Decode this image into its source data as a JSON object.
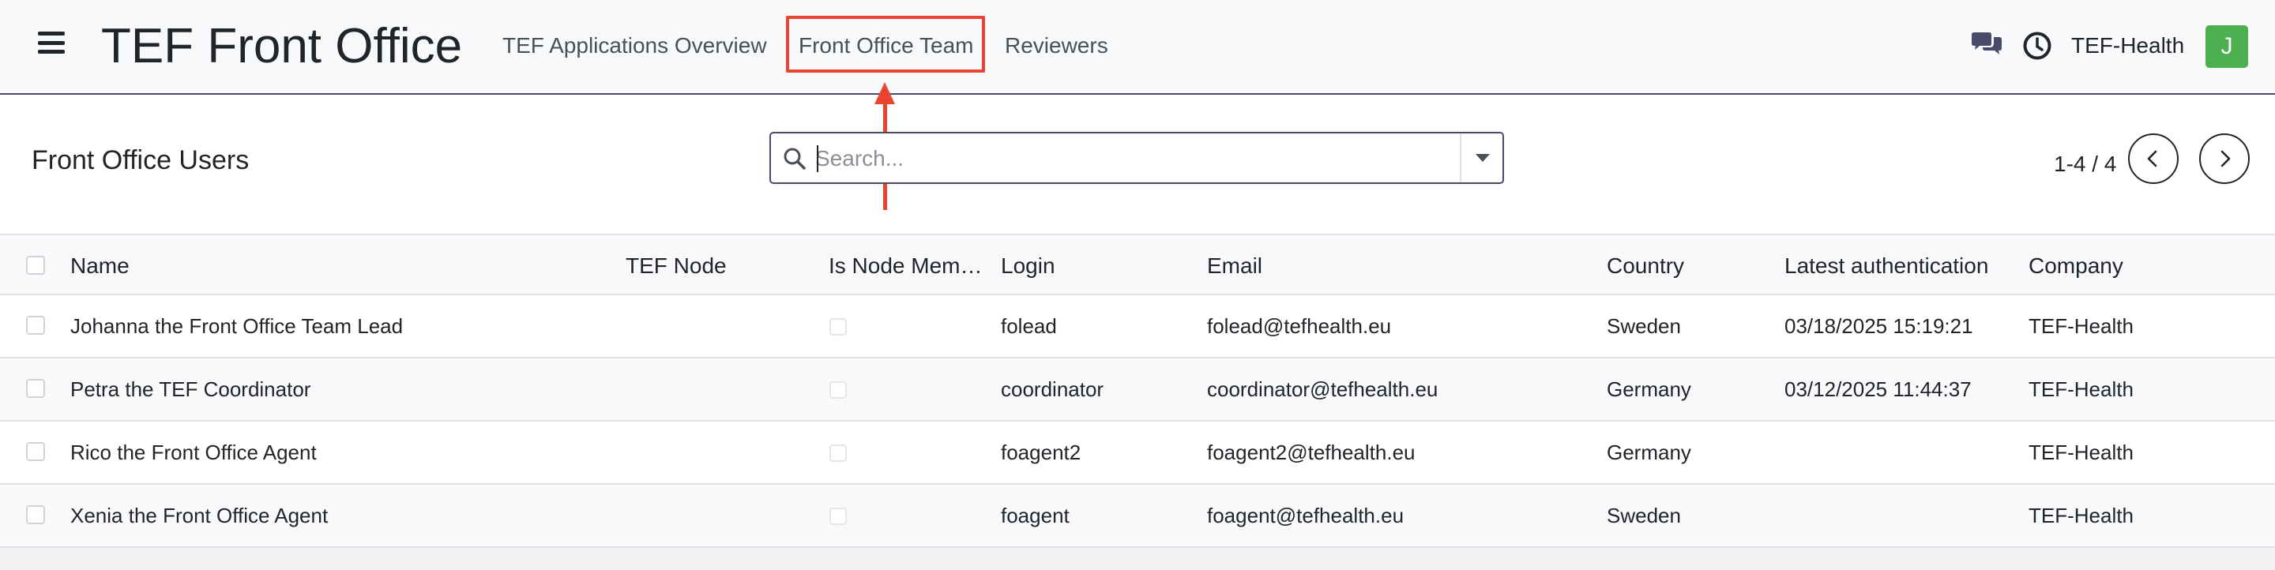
{
  "navbar": {
    "brand": "TEF Front Office",
    "menu": [
      {
        "label": "TEF Applications Overview"
      },
      {
        "label": "Front Office Team"
      },
      {
        "label": "Reviewers"
      }
    ],
    "company": "TEF-Health",
    "avatar_initial": "J",
    "icons": [
      "hamburger-icon",
      "chat-icon",
      "clock-icon"
    ]
  },
  "control_panel": {
    "title": "Front Office Users",
    "search": {
      "placeholder": "Search...",
      "value": ""
    },
    "pager": {
      "value": "1-4 / 4"
    }
  },
  "list": {
    "columns": [
      "Name",
      "TEF Node",
      "Is Node Mem…",
      "Login",
      "Email",
      "Country",
      "Latest authentication",
      "Company"
    ],
    "rows": [
      {
        "name": "Johanna the Front Office Team Lead",
        "tef_node": "",
        "login": "folead",
        "email": "folead@tefhealth.eu",
        "country": "Sweden",
        "latest_auth": "03/18/2025 15:19:21",
        "company": "TEF-Health"
      },
      {
        "name": "Petra the TEF Coordinator",
        "tef_node": "",
        "login": "coordinator",
        "email": "coordinator@tefhealth.eu",
        "country": "Germany",
        "latest_auth": "03/12/2025 11:44:37",
        "company": "TEF-Health"
      },
      {
        "name": "Rico the Front Office Agent",
        "tef_node": "",
        "login": "foagent2",
        "email": "foagent2@tefhealth.eu",
        "country": "Germany",
        "latest_auth": "",
        "company": "TEF-Health"
      },
      {
        "name": "Xenia the Front Office Agent",
        "tef_node": "",
        "login": "foagent",
        "email": "foagent@tefhealth.eu",
        "country": "Sweden",
        "latest_auth": "",
        "company": "TEF-Health"
      }
    ]
  },
  "colors": {
    "accent": "#4b4a6b",
    "highlight": "#e8442f",
    "avatar": "#4caf50"
  }
}
